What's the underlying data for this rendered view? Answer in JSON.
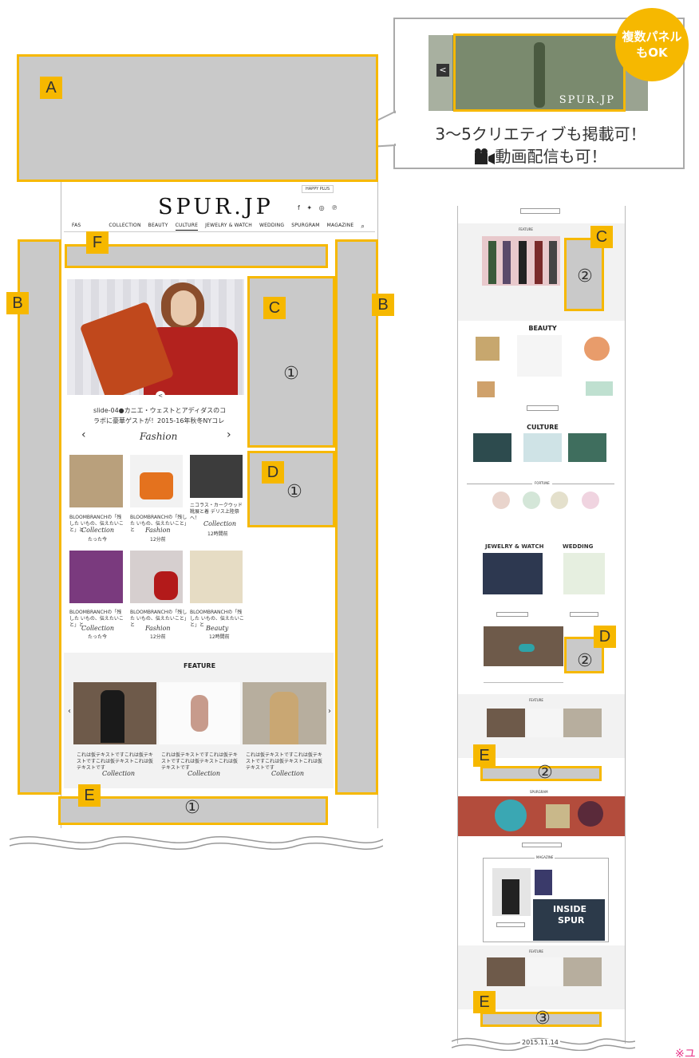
{
  "callout": {
    "badge_line1": "複数パネル",
    "badge_line2": "もOK",
    "preview_logo": "SPUR.JP",
    "line1": "3～5クリエティブも掲載可！",
    "line2": "動画配信も可！",
    "prev_arrow": "<",
    "camera_icon": "movie-camera-icon"
  },
  "labels": {
    "a": "A",
    "b_left": "B",
    "b_right": "B",
    "c1": "C",
    "c1_num": "①",
    "d1": "D",
    "d1_num": "①",
    "e1": "E",
    "e1_num": "①",
    "f": "F",
    "c2": "C",
    "c2_num": "②",
    "d2": "D",
    "d2_num": "②",
    "e2": "E",
    "e2_num": "②",
    "e3": "E",
    "e3_num": "③"
  },
  "site": {
    "top_link": "HAPPY PLUS",
    "logo": "SPUR.JP",
    "social": "f ✦ ◎ ℗",
    "nav": [
      "FAS",
      "COLLECTION",
      "BEAUTY",
      "CULTURE",
      "JEWELRY & WATCH",
      "WEDDING",
      "SPURGRAM",
      "MAGAZINE"
    ],
    "search_icon": "search-icon"
  },
  "hero": {
    "caption_line1": "slide-04●カニエ・ウェストとアディダスのコ",
    "caption_line2": "ラボに豪華ゲストが！2015-16年秋冬NYコレ",
    "category": "Fashion",
    "prev": "‹",
    "next": "›"
  },
  "grid": [
    {
      "text": "BLOOMBRANCHの「残した いもの、伝えたいこと」と",
      "category": "Collection",
      "date": "たった今"
    },
    {
      "text": "BLOOMBRANCHの「残した いもの、伝えたいこと」と",
      "category": "Fashion",
      "date": "12分前"
    },
    {
      "text": "ニコラス・カークウッド 靴展と着 デリス上陸祭へ！",
      "category": "Collection",
      "date": "12時間前"
    },
    {
      "text": "BLOOMBRANCHの「残した いもの、伝えたいこと」と",
      "category": "Collection",
      "date": "たった今"
    },
    {
      "text": "BLOOMBRANCHの「残した いもの、伝えたいこと」と",
      "category": "Fashion",
      "date": "12分前"
    },
    {
      "text": "BLOOMBRANCHの「残した いもの、伝えたいこと」と",
      "category": "Beauty",
      "date": "12時間前"
    }
  ],
  "feature": {
    "title": "FEATURE",
    "items": [
      {
        "text": "これは仮テキストですこれは仮テキストですこれは仮テキストこれは仮テキストです",
        "category": "Collection"
      },
      {
        "text": "これは仮テキストですこれは仮テキストですこれは仮テキストこれは仮テキストです",
        "category": "Collection"
      },
      {
        "text": "これは仮テキストですこれは仮テキストですこれは仮テキストこれは仮テキストです",
        "category": "Collection"
      }
    ]
  },
  "right_page": {
    "feature": "FEATURE",
    "beauty": "BEAUTY",
    "culture": "CULTURE",
    "fortune": "FORTUNE",
    "jewelry": "JEWELRY & WATCH",
    "wedding": "WEDDING",
    "feature2": "FEATURE",
    "spurgram": "SPURGRAM",
    "magazine": "MAGAZINE",
    "inside_spur_1": "INSIDE",
    "inside_spur_2": "SPUR",
    "feature3": "FEATURE",
    "date": "2015.11.14"
  },
  "corner_note": "※ユ"
}
